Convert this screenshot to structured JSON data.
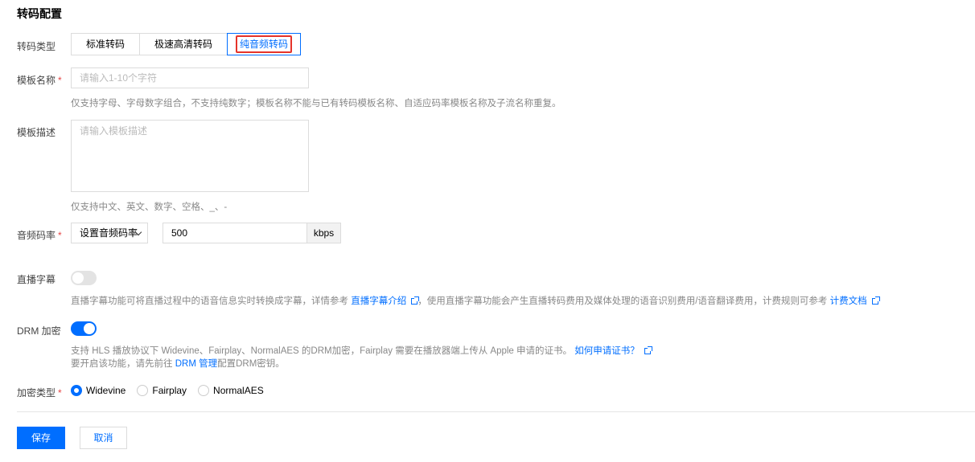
{
  "section_title": "转码配置",
  "transcode_type": {
    "label": "转码类型",
    "tabs": [
      "标准转码",
      "极速高清转码",
      "纯音频转码"
    ],
    "active_index": 2
  },
  "template_name": {
    "label": "模板名称",
    "required_mark": "*",
    "placeholder": "请输入1-10个字符",
    "hint": "仅支持字母、字母数字组合，不支持纯数字；模板名称不能与已有转码模板名称、自适应码率模板名称及子流名称重复。"
  },
  "template_desc": {
    "label": "模板描述",
    "placeholder": "请输入模板描述",
    "hint": "仅支持中文、英文、数字、空格、_、-"
  },
  "audio_bitrate": {
    "label": "音频码率",
    "required_mark": "*",
    "select_value": "设置音频码率",
    "value": "500",
    "unit": "kbps"
  },
  "live_subtitle": {
    "label": "直播字幕",
    "enabled": false,
    "hint_prefix": "直播字幕功能可将直播过程中的语音信息实时转换成字幕，详情参考",
    "link1": "直播字幕介绍",
    "hint_middle": "，使用直播字幕功能会产生直播转码费用及媒体处理的语音识别费用/语音翻译费用，计费规则可参考",
    "link2": "计费文档"
  },
  "drm": {
    "label": "DRM 加密",
    "enabled": true,
    "hint_line1": "支持 HLS 播放协议下 Widevine、Fairplay、NormalAES 的DRM加密，Fairplay 需要在播放器端上传从 Apple 申请的证书。",
    "link_cert": "如何申请证书？",
    "hint_line2_prefix": "要开启该功能，请先前往",
    "link_drm": "DRM 管理",
    "hint_line2_suffix": "配置DRM密钥。"
  },
  "encrypt_type": {
    "label": "加密类型",
    "required_mark": "*",
    "options": [
      "Widevine",
      "Fairplay",
      "NormalAES"
    ],
    "selected_index": 0
  },
  "buttons": {
    "save": "保存",
    "cancel": "取消"
  },
  "colors": {
    "primary": "#006eff",
    "required": "#e54545",
    "highlight_box": "#e5332a"
  }
}
